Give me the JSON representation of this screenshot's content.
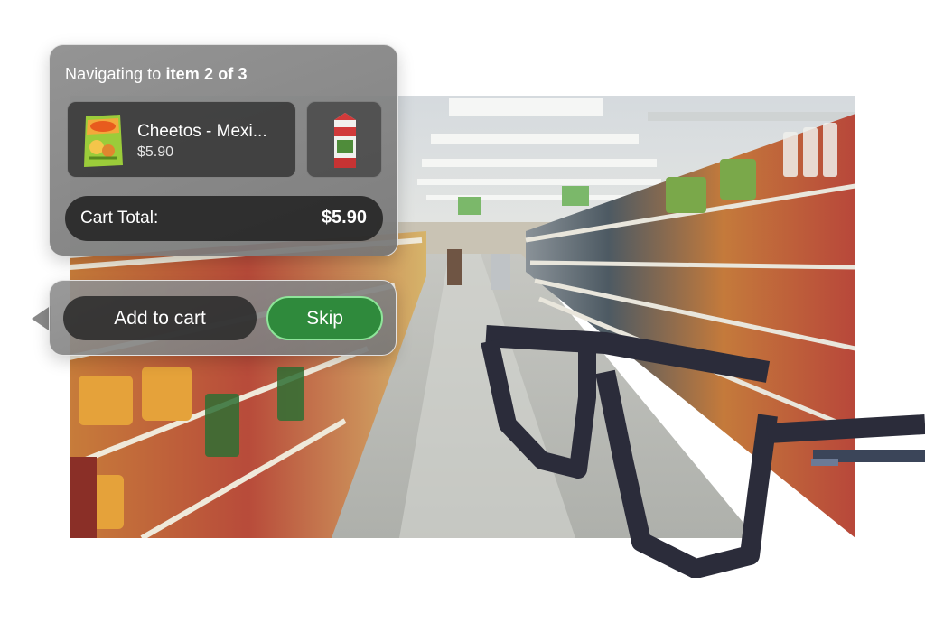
{
  "navigation": {
    "prefix": "Navigating to ",
    "position": "item 2 of 3"
  },
  "current_item": {
    "name": "Cheetos - Mexi...",
    "price": "$5.90",
    "thumbnail_icon": "cheetos-bag-icon"
  },
  "next_item": {
    "thumbnail_icon": "milk-carton-icon"
  },
  "cart": {
    "label": "Cart Total:",
    "total": "$5.90"
  },
  "actions": {
    "add_label": "Add to cart",
    "skip_label": "Skip"
  },
  "colors": {
    "skip_green": "#2f8a3c",
    "skip_border": "#8fe59a",
    "panel_dark": "#1c1c1c",
    "glasses": "#2b2c3a"
  }
}
